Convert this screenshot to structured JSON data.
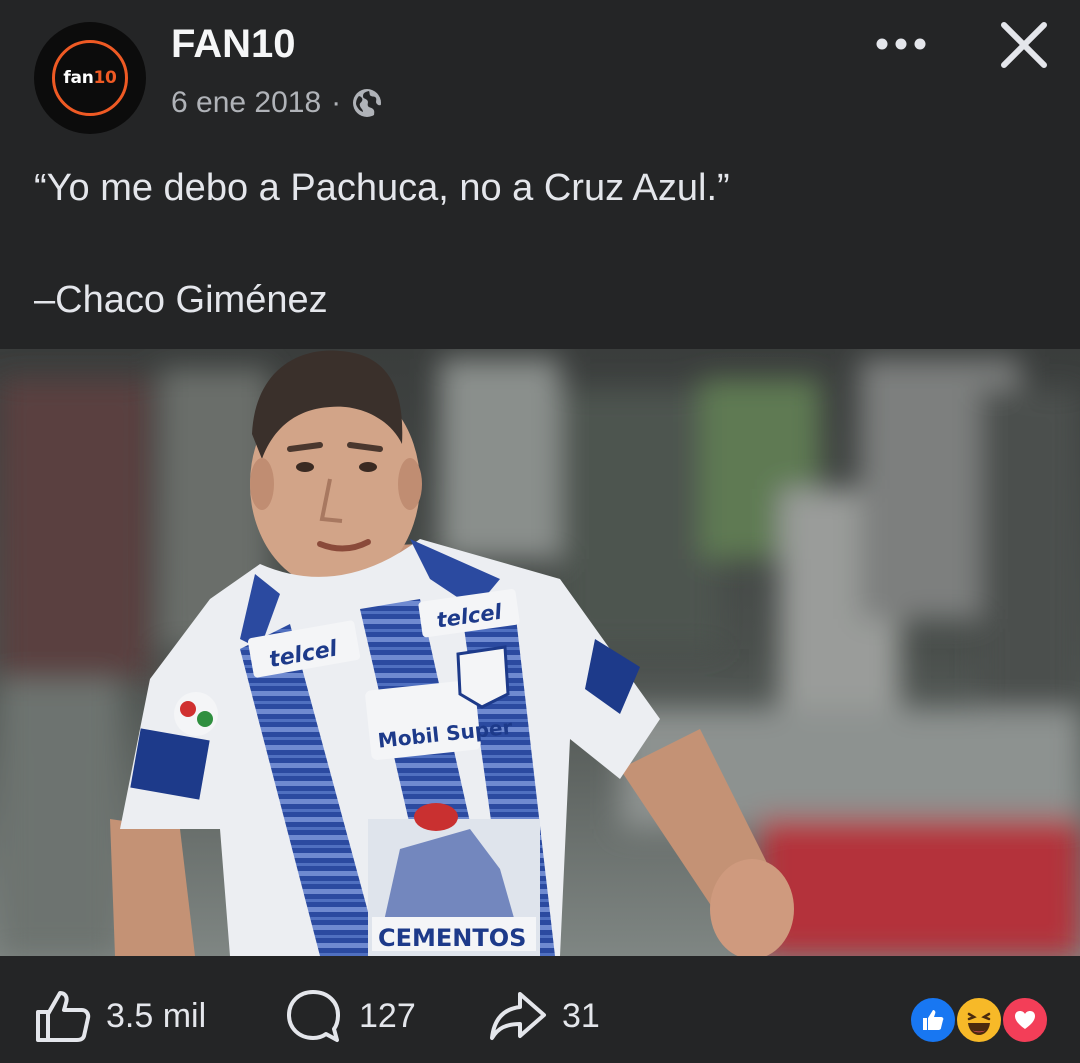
{
  "post": {
    "author": "FAN10",
    "avatar_text_main": "fan",
    "avatar_text_number": "10",
    "date": "6 ene 2018",
    "separator": "·",
    "privacy_icon": "globe-icon",
    "caption_lines": [
      "“Yo me debo a Pachuca, no a Cruz Azul.”",
      "",
      "–Chaco Giménez"
    ]
  },
  "header_actions": {
    "more_icon": "more-dots-icon",
    "close_icon": "close-icon"
  },
  "photo": {
    "jersey_sponsors": [
      "telcel",
      "telcel",
      "Mobil Super",
      "CEMENTOS"
    ]
  },
  "engagement": {
    "likes": "3.5 mil",
    "comments": "127",
    "shares": "31",
    "reactions": [
      "like",
      "haha",
      "love"
    ]
  },
  "colors": {
    "background": "#242526",
    "text": "#e4e6eb",
    "muted_text": "#b0b3b8",
    "brand_orange": "#ef5a24",
    "like_blue": "#1877f2",
    "love_red": "#f33e58",
    "haha_yellow": "#f7b928"
  }
}
